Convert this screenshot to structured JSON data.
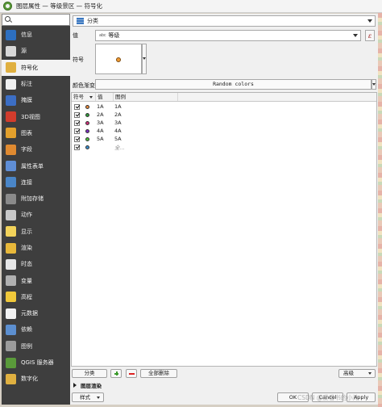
{
  "window": {
    "title": "图层属性 — 等级景区 — 符号化"
  },
  "sidebar": {
    "search_placeholder": "",
    "items": [
      {
        "label": "信息",
        "icon": "info-icon",
        "color": "#2d6fc0"
      },
      {
        "label": "源",
        "icon": "source-icon",
        "color": "#d8d8d8"
      },
      {
        "label": "符号化",
        "icon": "paintbrush-icon",
        "color": "#e0b040"
      },
      {
        "label": "标注",
        "icon": "labels-icon",
        "color": "#f0f0f0"
      },
      {
        "label": "掩膜",
        "icon": "mask-icon",
        "color": "#3c6ec4"
      },
      {
        "label": "3D视图",
        "icon": "cube-icon",
        "color": "#d23c2c"
      },
      {
        "label": "图表",
        "icon": "diagram-icon",
        "color": "#e3a02c"
      },
      {
        "label": "字段",
        "icon": "fields-icon",
        "color": "#e08a30"
      },
      {
        "label": "属性表单",
        "icon": "form-icon",
        "color": "#5f8ed6"
      },
      {
        "label": "连接",
        "icon": "join-icon",
        "color": "#4a86c8"
      },
      {
        "label": "附加存储",
        "icon": "storage-icon",
        "color": "#8a8a8a"
      },
      {
        "label": "动作",
        "icon": "gear-icon",
        "color": "#c9c9c9"
      },
      {
        "label": "显示",
        "icon": "display-icon",
        "color": "#f2d25a"
      },
      {
        "label": "渲染",
        "icon": "render-icon",
        "color": "#e8b83a"
      },
      {
        "label": "时态",
        "icon": "clock-icon",
        "color": "#e6e6e6"
      },
      {
        "label": "变量",
        "icon": "variable-icon",
        "color": "#b0b0b0"
      },
      {
        "label": "高程",
        "icon": "elevation-icon",
        "color": "#f0c83a"
      },
      {
        "label": "元数据",
        "icon": "metadata-icon",
        "color": "#f2f2f2"
      },
      {
        "label": "依赖",
        "icon": "dependency-icon",
        "color": "#5c8fd0"
      },
      {
        "label": "图例",
        "icon": "legend-icon",
        "color": "#9c9c9c"
      },
      {
        "label": "QGIS 服务器",
        "icon": "server-icon",
        "color": "#5a9a3a"
      },
      {
        "label": "数字化",
        "icon": "digitize-icon",
        "color": "#e0b040"
      }
    ],
    "active_index": 2
  },
  "renderer": {
    "type_label": "分类"
  },
  "value": {
    "label": "值",
    "field_type": "abc",
    "field_name": "等级"
  },
  "symbol": {
    "label": "符号",
    "fill_color": "#ef9a32"
  },
  "color_ramp": {
    "label": "颜色渐变",
    "value": "Random colors"
  },
  "table": {
    "headers": {
      "symbol": "符号",
      "value": "值",
      "legend": "图例"
    },
    "rows": [
      {
        "value": "1A",
        "legend": "1A",
        "color": "#e88a3c",
        "checked": true
      },
      {
        "value": "2A",
        "legend": "2A",
        "color": "#2e9a3a",
        "checked": true
      },
      {
        "value": "3A",
        "legend": "3A",
        "color": "#d02e7a",
        "checked": true
      },
      {
        "value": "4A",
        "legend": "4A",
        "color": "#7a2fc0",
        "checked": true
      },
      {
        "value": "5A",
        "legend": "5A",
        "color": "#4ac23a",
        "checked": true
      },
      {
        "value": "",
        "legend": "全...",
        "color": "#3a8fd0",
        "checked": true
      }
    ]
  },
  "buttons": {
    "classify": "分类",
    "delete_all": "全部删除",
    "advanced": "高级",
    "ok": "OK",
    "cancel": "Cancel",
    "apply": "Apply"
  },
  "layer_rendering": {
    "label": "图层渲染"
  },
  "style": {
    "label": "样式"
  },
  "watermark": "CSDN @爱看书的小沐"
}
